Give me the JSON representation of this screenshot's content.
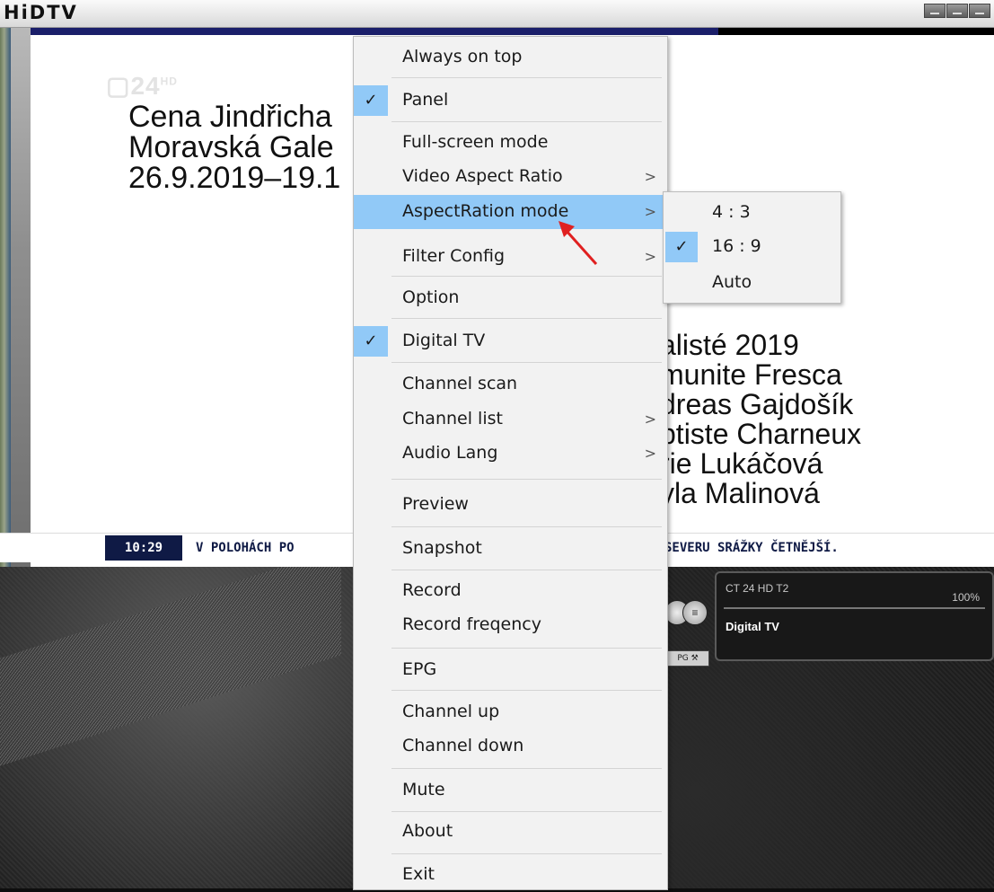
{
  "window": {
    "title": "HiDTV",
    "controls": [
      "minimize-icon",
      "restore-icon",
      "close-icon"
    ]
  },
  "video": {
    "logo": "24",
    "logo_sup": "HD",
    "headline": "Cena Jindřicha\nMoravská Gale\n26.9.2019–19.1",
    "names": "alisté 2019\nmunite Fresca\ndreas Gajdošík\nptiste Charneux\nrie Lukáčová\nyla Malinová",
    "ticker_time": "10:29",
    "ticker_left": "V POLOHÁCH PO",
    "ticker_right": "SEVERU SRÁŽKY ČETNĚJŠÍ."
  },
  "panel": {
    "channel": "CT 24 HD T2",
    "signal": "100%",
    "mode": "Digital TV",
    "tab_label": "PG ⚒"
  },
  "menu": {
    "items": [
      {
        "label": "Always on top"
      },
      {
        "label": "Panel",
        "checked": true
      },
      {
        "label": "Full-screen mode"
      },
      {
        "label": "Video Aspect Ratio",
        "submenu": true
      },
      {
        "label": "AspectRation mode",
        "submenu": true,
        "highlighted": true
      },
      {
        "label": "Filter Config",
        "submenu": true
      },
      {
        "label": "Option"
      },
      {
        "label": "Digital TV",
        "checked": true
      },
      {
        "label": "Channel scan"
      },
      {
        "label": "Channel list",
        "submenu": true
      },
      {
        "label": "Audio Lang",
        "submenu": true
      },
      {
        "label": "Preview"
      },
      {
        "label": "Snapshot"
      },
      {
        "label": "Record"
      },
      {
        "label": "Record freqency"
      },
      {
        "label": "EPG"
      },
      {
        "label": "Channel up"
      },
      {
        "label": "Channel down"
      },
      {
        "label": "Mute"
      },
      {
        "label": "About"
      },
      {
        "label": "Exit"
      }
    ],
    "submenu_items": [
      {
        "label": "4 : 3"
      },
      {
        "label": "16 : 9",
        "checked": true
      },
      {
        "label": "Auto"
      }
    ],
    "check_glyph": "✓",
    "arrow_glyph": ">"
  },
  "colors": {
    "highlight": "#91c9f7",
    "annotation_arrow": "#e02020"
  }
}
